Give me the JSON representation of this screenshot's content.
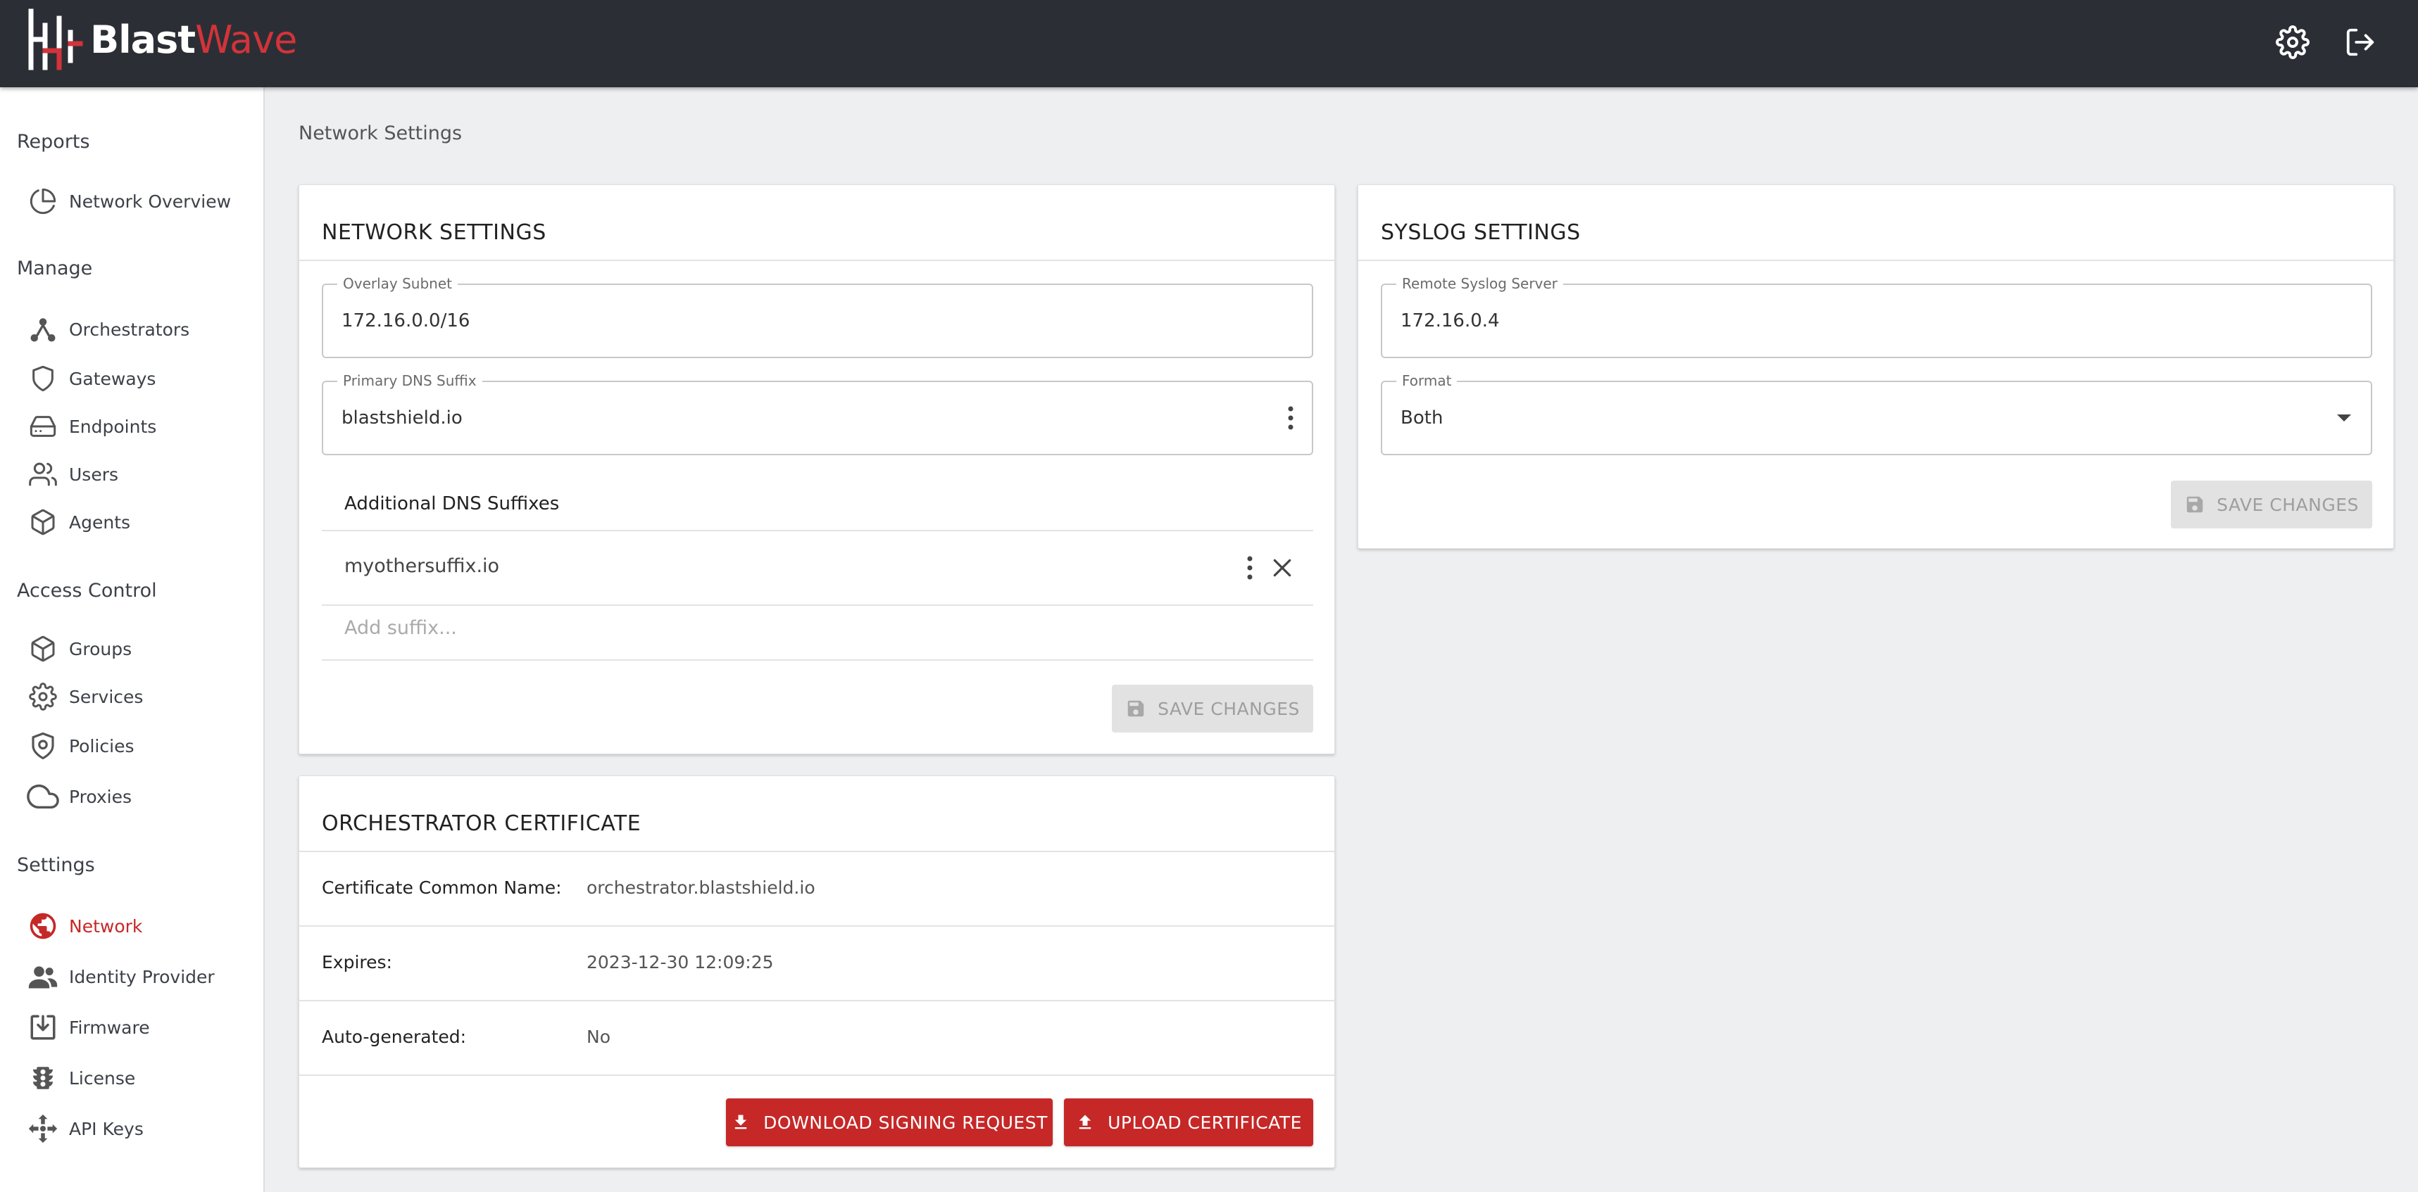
{
  "app": {
    "brand_part1": "Blast",
    "brand_part2": "Wave",
    "brand_colors": {
      "primary": "#c62828",
      "header_bg": "#2b2f35"
    }
  },
  "header": {
    "icons": [
      "gear-icon",
      "logout-icon"
    ]
  },
  "sidebar": {
    "sections": [
      {
        "title": "Reports",
        "items": [
          {
            "label": "Network Overview",
            "icon": "pie-chart-icon"
          }
        ]
      },
      {
        "title": "Manage",
        "items": [
          {
            "label": "Orchestrators",
            "icon": "hub-icon"
          },
          {
            "label": "Gateways",
            "icon": "shield-icon"
          },
          {
            "label": "Endpoints",
            "icon": "hard-drive-icon"
          },
          {
            "label": "Users",
            "icon": "users-icon"
          },
          {
            "label": "Agents",
            "icon": "package-icon"
          }
        ]
      },
      {
        "title": "Access Control",
        "items": [
          {
            "label": "Groups",
            "icon": "box-icon"
          },
          {
            "label": "Services",
            "icon": "gear-icon"
          },
          {
            "label": "Policies",
            "icon": "shield-check-icon"
          },
          {
            "label": "Proxies",
            "icon": "cloud-icon"
          }
        ]
      },
      {
        "title": "Settings",
        "items": [
          {
            "label": "Network",
            "icon": "globe-icon",
            "active": true
          },
          {
            "label": "Identity Provider",
            "icon": "people-icon"
          },
          {
            "label": "Firmware",
            "icon": "download-box-icon"
          },
          {
            "label": "License",
            "icon": "traffic-light-icon"
          },
          {
            "label": "API Keys",
            "icon": "move-icon"
          }
        ]
      }
    ]
  },
  "breadcrumb": "Network Settings",
  "network_settings": {
    "title": "NETWORK SETTINGS",
    "overlay_subnet": {
      "label": "Overlay Subnet",
      "value": "172.16.0.0/16"
    },
    "primary_dns": {
      "label": "Primary DNS Suffix",
      "value": "blastshield.io"
    },
    "additional_dns": {
      "header": "Additional DNS Suffixes",
      "items": [
        "myothersuffix.io"
      ],
      "placeholder": "Add suffix..."
    },
    "save_label": "SAVE CHANGES"
  },
  "syslog_settings": {
    "title": "SYSLOG SETTINGS",
    "remote_server": {
      "label": "Remote Syslog Server",
      "value": "172.16.0.4"
    },
    "format": {
      "label": "Format",
      "value": "Both"
    },
    "save_label": "SAVE CHANGES"
  },
  "orchestrator_certificate": {
    "title": "ORCHESTRATOR CERTIFICATE",
    "rows": [
      {
        "label": "Certificate Common Name:",
        "value": "orchestrator.blastshield.io"
      },
      {
        "label": "Expires:",
        "value": "2023-12-30 12:09:25"
      },
      {
        "label": "Auto-generated:",
        "value": "No"
      }
    ],
    "download_label": "DOWNLOAD SIGNING REQUEST",
    "upload_label": "UPLOAD CERTIFICATE"
  }
}
